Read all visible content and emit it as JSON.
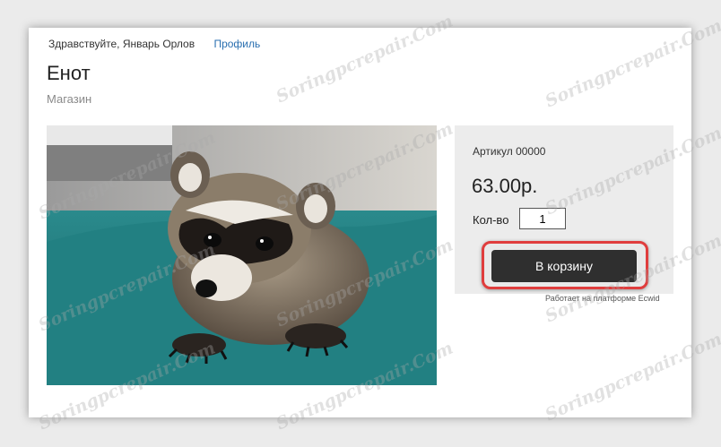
{
  "header": {
    "greeting": "Здравствуйте, Январь Орлов",
    "profile_link": "Профиль"
  },
  "product": {
    "title": "Енот",
    "breadcrumb": "Магазин",
    "image_alt": "raccoon-photo"
  },
  "purchase": {
    "sku": "Артикул 00000",
    "price": "63.00р.",
    "qty_label": "Кол-во",
    "qty_value": "1",
    "cart_button": "В корзину",
    "powered_by": "Работает на платформе Ecwid",
    "highlight_color": "#e03d3d"
  },
  "watermark": "Soringpcrepair.Com"
}
